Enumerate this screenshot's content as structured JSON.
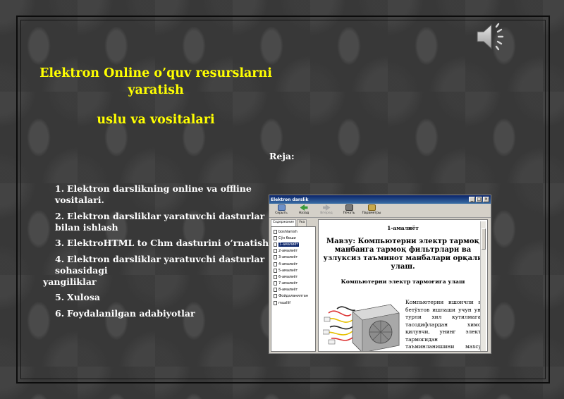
{
  "slide": {
    "title": "Elektron Online o’quv resurslarni yaratish",
    "subtitle": "uslu va vositalari",
    "plan_heading": "Reja:",
    "plan_items": [
      {
        "num": "1.",
        "text": "Elektron darslikning online va offline vositalari."
      },
      {
        "num": "2.",
        "text": "Elektron darsliklar yaratuvchi dasturlar bilan ishlash"
      },
      {
        "num": "3.",
        "text": "ElektroHTML to Chm dasturini  o’rnatish."
      },
      {
        "num": "4.",
        "text": "Elektron darsliklar yaratuvchi dasturlar sohasidagi",
        "text2": "yangiliklar"
      },
      {
        "num": "5.",
        "text": "Xulosa"
      },
      {
        "num": "6.",
        "text": "Foydalanilgan adabiyotlar"
      }
    ],
    "title_color": "#ffff00",
    "speaker_icon": "speaker-icon"
  },
  "app_window": {
    "title": "Elektron darslik",
    "window_buttons": [
      "_",
      "□",
      "×"
    ],
    "toolbar": [
      {
        "label": "Скрыть",
        "icon": "hide-icon",
        "enabled": true
      },
      {
        "label": "Назад",
        "icon": "back-icon",
        "enabled": true
      },
      {
        "label": "Вперед",
        "icon": "forward-icon",
        "enabled": false
      },
      {
        "label": "Печать",
        "icon": "print-icon",
        "enabled": true
      },
      {
        "label": "Параметры",
        "icon": "options-icon",
        "enabled": true
      }
    ],
    "nav_tabs": [
      "Содержание",
      "Ука"
    ],
    "tree_items": [
      "boshlanish",
      "Сўз боши",
      "1-амалиёт",
      "2-амалиёт",
      "3-амалиёт",
      "4-амалиёт",
      "5-амалиёт",
      "6-амалиёт",
      "7-амалиёт",
      "8-амалиёт",
      "Фойдаланилган",
      "muallif"
    ],
    "selected_tree_index": 2,
    "content": {
      "heading": "1-амалиёт",
      "topic": "Мавзу: Компьютерни электр тармоқ манбаига тармоқ фильтрлари ва узлуксиз таъминот манбалари орқали улаш.",
      "subheading": "Компьютерни электр тармоғига улаш",
      "paragraph": "Компьютерни ишончли ва бетўхтов ишлаши учун уни турли хил кутилмаган тасодифлардан химоя қилувчи, унинг электр тармоғидан таъминланишини махсус тизимини кўзда тутиш керак. Бу кутилмаган тасодифлар, биринчи навбатда электр"
    }
  }
}
